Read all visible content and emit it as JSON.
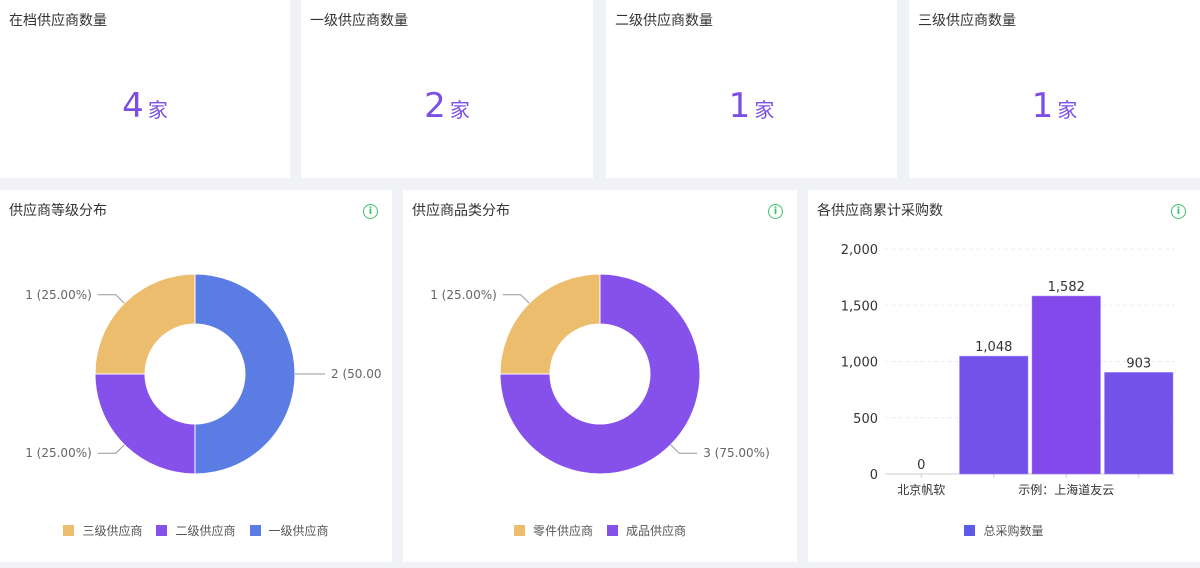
{
  "kpis": [
    {
      "title": "在档供应商数量",
      "value": "4",
      "unit": "家"
    },
    {
      "title": "一级供应商数量",
      "value": "2",
      "unit": "家"
    },
    {
      "title": "二级供应商数量",
      "value": "1",
      "unit": "家"
    },
    {
      "title": "三级供应商数量",
      "value": "1",
      "unit": "家"
    }
  ],
  "chart_data": [
    {
      "type": "pie",
      "title": "供应商等级分布",
      "slices": [
        {
          "name": "一级供应商",
          "value": 2,
          "label": "2 (50.00",
          "color": "#5b7de3"
        },
        {
          "name": "二级供应商",
          "value": 1,
          "label": "1 (25.00%)",
          "color": "#8650ea"
        },
        {
          "name": "三级供应商",
          "value": 1,
          "label": "1 (25.00%)",
          "color": "#ecbd6c"
        }
      ],
      "legend": [
        "三级供应商",
        "二级供应商",
        "一级供应商"
      ]
    },
    {
      "type": "pie",
      "title": "供应商品类分布",
      "slices": [
        {
          "name": "成品供应商",
          "value": 3,
          "label": "3 (75.00%)",
          "color": "#8650ea"
        },
        {
          "name": "零件供应商",
          "value": 1,
          "label": "1 (25.00%)",
          "color": "#ecbd6c"
        }
      ],
      "legend": [
        "零件供应商",
        "成品供应商"
      ]
    },
    {
      "type": "bar",
      "title": "各供应商累计采购数",
      "categories": [
        "北京帆软",
        "",
        "示例：上海道友云",
        ""
      ],
      "values": [
        0,
        1048,
        1582,
        903
      ],
      "value_labels": [
        "0",
        "1,048",
        "1,582",
        "903"
      ],
      "ylim": [
        0,
        2000
      ],
      "yticks": [
        "0",
        "500",
        "1,000",
        "1,500",
        "2,000"
      ],
      "series_name": "总采购数量",
      "color": "#7352ea",
      "legend": "bottom"
    }
  ]
}
